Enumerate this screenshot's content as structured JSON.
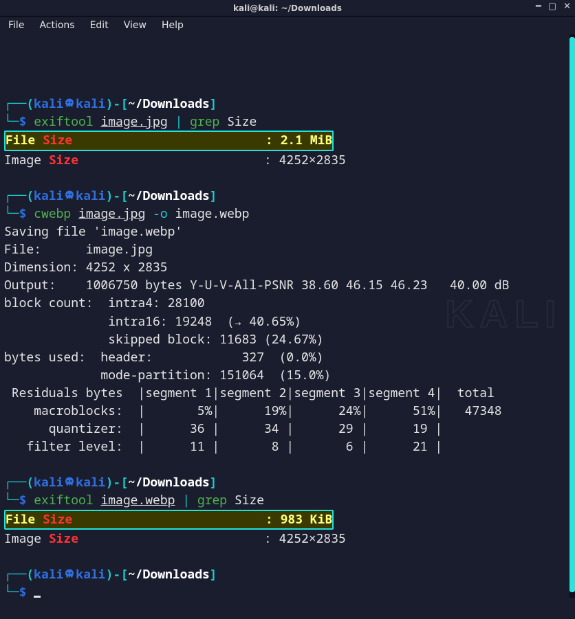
{
  "window": {
    "title": "kali@kali: ~/Downloads"
  },
  "menu": {
    "file": "File",
    "actions": "Actions",
    "edit": "Edit",
    "view": "View",
    "help": "Help"
  },
  "prompt": {
    "l1": "┌──(",
    "user": "kali",
    "host": "kali",
    "l2": ")-[",
    "cwd": "~/Downloads",
    "l3": "]",
    "l4": "└─",
    "dollar": "$"
  },
  "cmd1": {
    "cmd": "exiftool",
    "arg": "image.jpg",
    "pipe": "|",
    "grep": "grep",
    "grep_arg": "Size"
  },
  "out1": {
    "label_file": "File ",
    "label_size": "Size",
    "spacer": "                          ",
    "colon_val": ": 2.1 MiB",
    "img_label": "Image ",
    "img_size_lbl": "Size",
    "img_spacer": "                         ",
    "img_val": ": 4252×2835"
  },
  "cmd2": {
    "cmd": "cwebp",
    "arg": "image.jpg",
    "flag": "-o",
    "out": "image.webp"
  },
  "cwebp_out": {
    "l1": "Saving file 'image.webp'",
    "l2": "File:      image.jpg",
    "l3": "Dimension: 4252 x 2835",
    "l4": "Output:    1006750 bytes Y-U-V-All-PSNR 38.60 46.15 46.23   40.00 dB",
    "l5": "block count:  intra4: 28100",
    "l6": "              intra16: 19248  (→ 40.65%)",
    "l7": "              skipped block: 11683 (24.67%)",
    "l8": "bytes used:  header:            327  (0.0%)",
    "l9": "             mode-partition: 151064  (15.0%)",
    "l10": " Residuals bytes  |segment 1|segment 2|segment 3|segment 4|  total",
    "l11": "    macroblocks:  |       5%|      19%|      24%|      51%|   47348",
    "l12": "      quantizer:  |      36 |      34 |      29 |      19 |",
    "l13": "   filter level:  |      11 |       8 |       6 |      21 |"
  },
  "cmd3": {
    "cmd": "exiftool",
    "arg": "image.webp",
    "pipe": "|",
    "grep": "grep",
    "grep_arg": "Size"
  },
  "out3": {
    "label_file": "File ",
    "label_size": "Size",
    "spacer": "                          ",
    "colon_val": ": 983 KiB",
    "img_label": "Image ",
    "img_size_lbl": "Size",
    "img_spacer": "                         ",
    "img_val": ": 4252×2835"
  },
  "watermark": "KALI"
}
